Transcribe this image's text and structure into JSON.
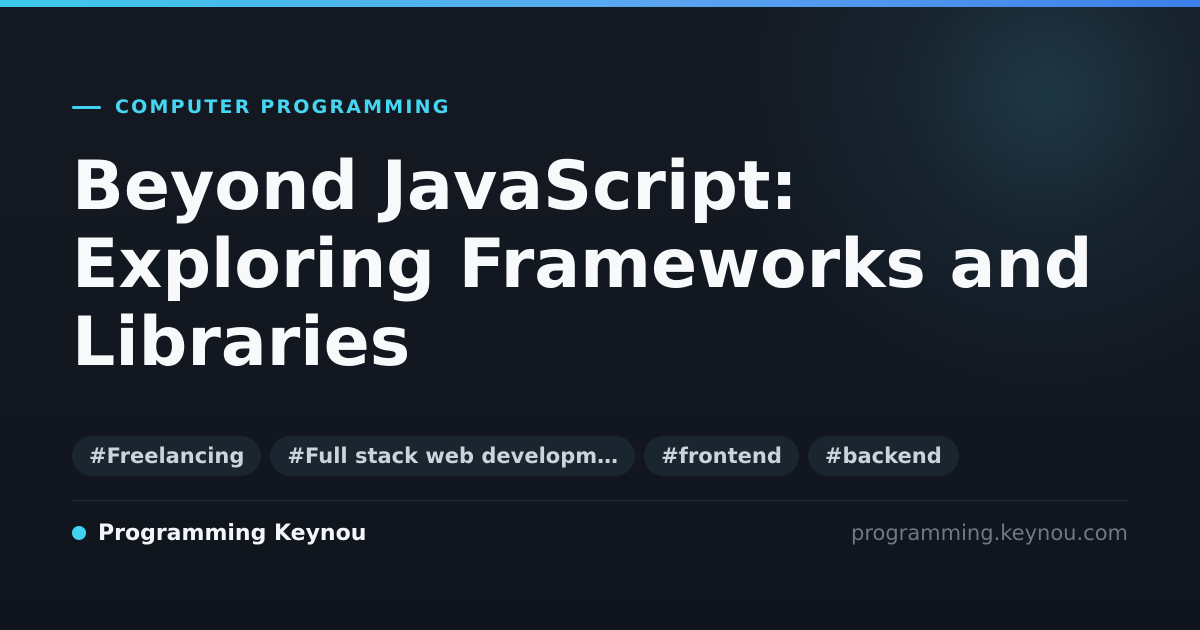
{
  "category": "COMPUTER PROGRAMMING",
  "title_lines": [
    "Beyond JavaScript:",
    "Exploring Frameworks and",
    "Libraries"
  ],
  "tags": [
    "#Freelancing",
    "#Full stack web developm…",
    "#frontend",
    "#backend"
  ],
  "footer": {
    "brand_name": "Programming Keynou",
    "site_url": "programming.keynou.com"
  },
  "colors": {
    "accent": "#3fd3f0",
    "background": "#121721",
    "title": "#f7f9fb",
    "tag_background": "#1b2530",
    "tag_text": "#cbd3dc",
    "url_text": "#6d7986"
  }
}
